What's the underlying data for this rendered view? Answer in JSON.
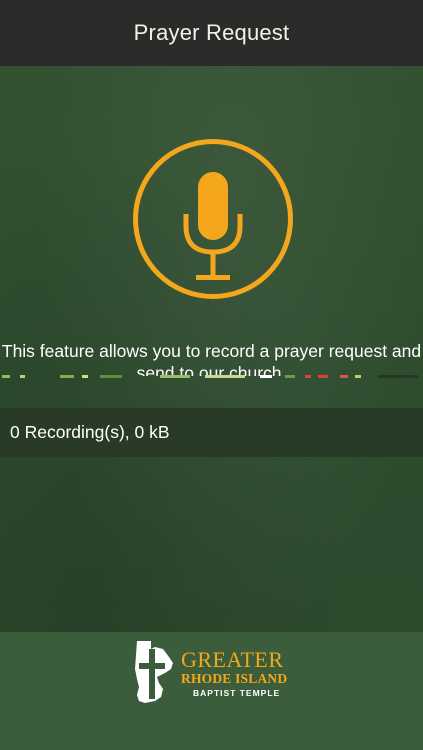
{
  "header": {
    "title": "Prayer Request"
  },
  "record_button": {
    "icon": "microphone-icon",
    "color": "#f4a61d"
  },
  "description": {
    "line1": "This feature allows you to record a prayer request and",
    "line2": "send to our church."
  },
  "recordings": {
    "status": "0 Recording(s), 0 kB"
  },
  "logo": {
    "line1": "GREATER",
    "line2": "RHODE ISLAND",
    "line3": "BAPTIST TEMPLE"
  },
  "colors": {
    "header_bg": "#2b2c2a",
    "background": "#2f4c2f",
    "accent": "#f4a61d",
    "recordings_bar": "#273b27",
    "footer": "#3c5d3b"
  }
}
